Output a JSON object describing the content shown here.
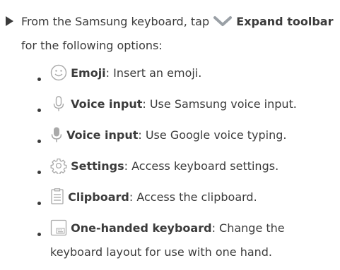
{
  "intro": {
    "text_before": "From the Samsung keyboard, tap ",
    "expand_label": "Expand toolbar",
    "text_after": " for the following options:"
  },
  "items": [
    {
      "icon": "emoji-icon",
      "label": "Emoji",
      "desc": ": Insert an emoji."
    },
    {
      "icon": "microphone-outline-icon",
      "label": "Voice input",
      "desc": ": Use Samsung voice input."
    },
    {
      "icon": "microphone-filled-icon",
      "label": "Voice input",
      "desc": ": Use Google voice typing."
    },
    {
      "icon": "gear-icon",
      "label": "Settings",
      "desc": ": Access keyboard settings."
    },
    {
      "icon": "clipboard-icon",
      "label": "Clipboard",
      "desc": ": Access the clipboard."
    },
    {
      "icon": "one-handed-keyboard-icon",
      "label": "One-handed keyboard",
      "desc": ": Change the keyboard layout for use with one hand."
    }
  ],
  "colors": {
    "text": "#3b3b3b",
    "icon": "#a9a9a9",
    "chevron": "#9aa0a6"
  }
}
